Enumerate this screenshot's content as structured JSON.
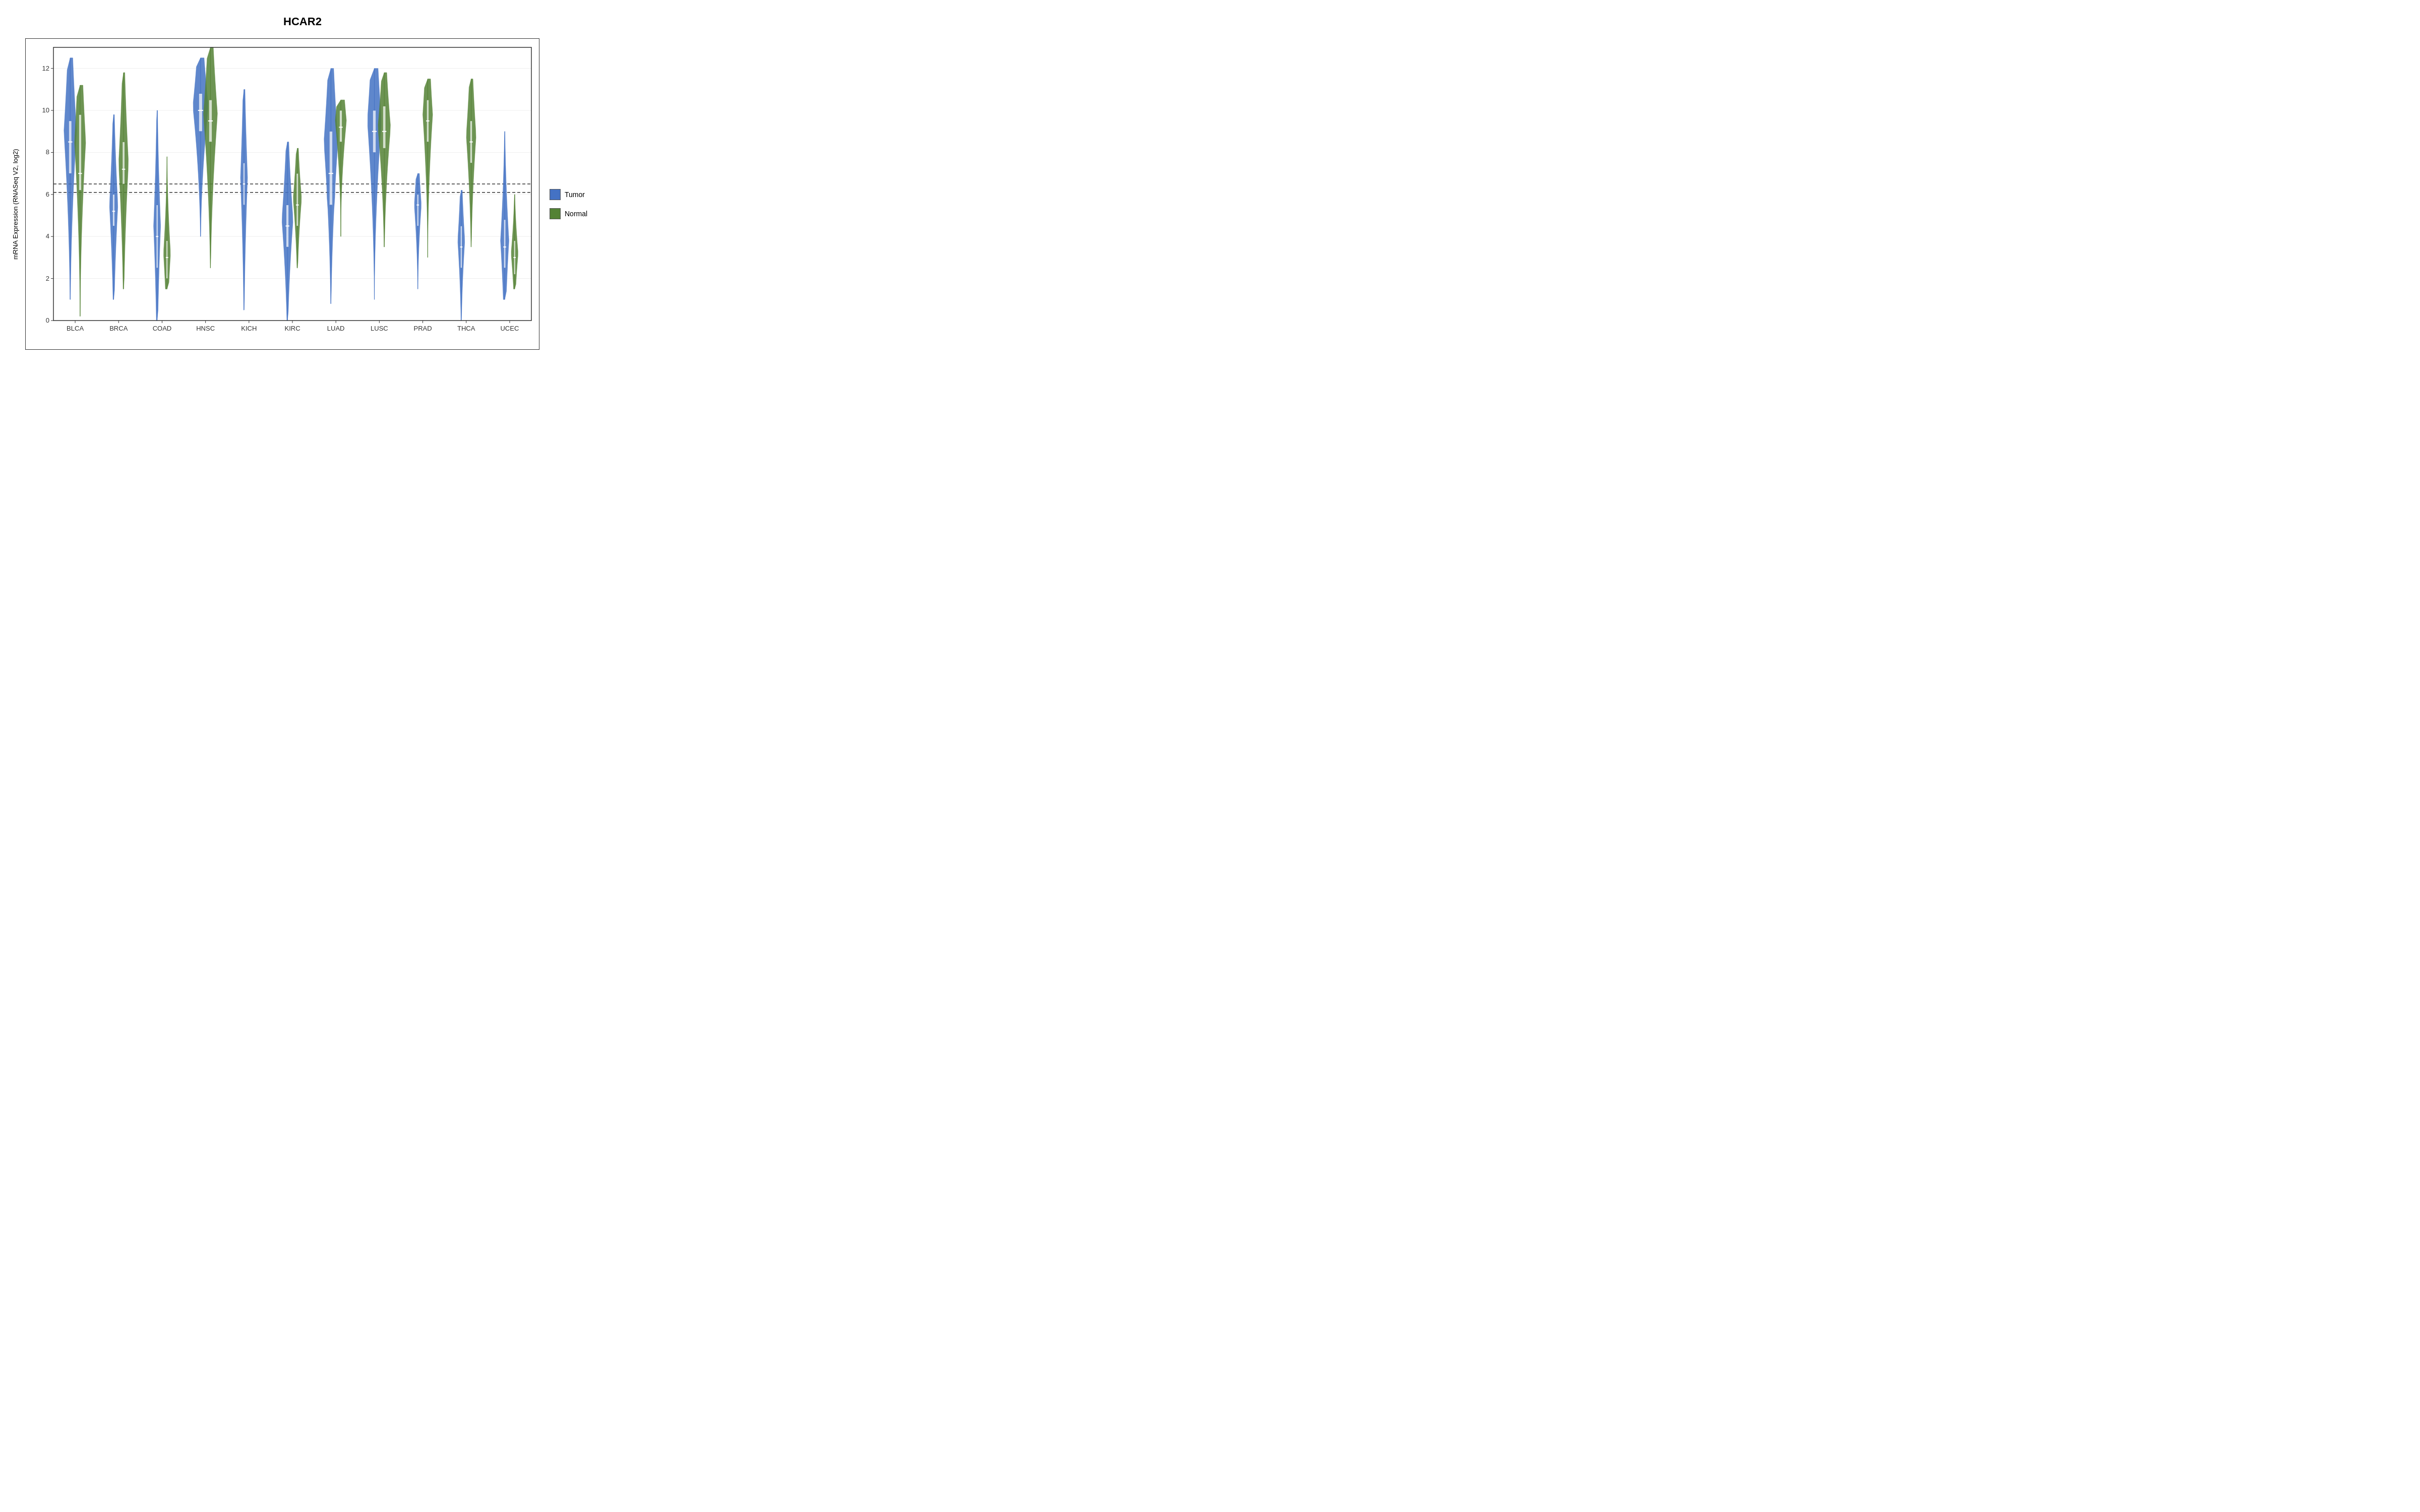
{
  "title": "HCAR2",
  "yAxisLabel": "mRNA Expression (RNASeq V2, log2)",
  "legend": {
    "tumor": {
      "label": "Tumor",
      "color": "#4472C4"
    },
    "normal": {
      "label": "Normal",
      "color": "#548235"
    }
  },
  "yAxis": {
    "min": 0,
    "max": 13,
    "ticks": [
      0,
      2,
      4,
      6,
      8,
      10,
      12
    ]
  },
  "referenceLine1": 6.5,
  "referenceLine2": 6.1,
  "cancerTypes": [
    "BLCA",
    "BRCA",
    "COAD",
    "HNSC",
    "KICH",
    "KIRC",
    "LUAD",
    "LUSC",
    "PRAD",
    "THCA",
    "UCEC"
  ],
  "violins": {
    "BLCA": {
      "tumor": {
        "median": 8.5,
        "q1": 7.0,
        "q3": 9.5,
        "min": 1.0,
        "max": 12.5,
        "mode": 9.0,
        "width": 0.9
      },
      "normal": {
        "median": 7.0,
        "q1": 6.2,
        "q3": 9.8,
        "min": 0.2,
        "max": 11.2,
        "mode": 8.5,
        "width": 0.8
      }
    },
    "BRCA": {
      "tumor": {
        "median": 5.2,
        "q1": 4.5,
        "q3": 6.0,
        "min": 1.0,
        "max": 9.8,
        "mode": 5.5,
        "width": 0.6
      },
      "normal": {
        "median": 7.2,
        "q1": 6.5,
        "q3": 8.5,
        "min": 1.5,
        "max": 11.8,
        "mode": 7.5,
        "width": 0.7
      }
    },
    "COAD": {
      "tumor": {
        "median": 4.0,
        "q1": 2.5,
        "q3": 5.5,
        "min": 0.0,
        "max": 10.0,
        "mode": 4.5,
        "width": 0.5
      },
      "normal": {
        "median": 3.0,
        "q1": 2.0,
        "q3": 3.8,
        "min": 1.5,
        "max": 7.8,
        "mode": 3.2,
        "width": 0.5
      }
    },
    "HNSC": {
      "tumor": {
        "median": 10.0,
        "q1": 9.0,
        "q3": 10.8,
        "min": 4.0,
        "max": 12.5,
        "mode": 10.2,
        "width": 1.1
      },
      "normal": {
        "median": 9.5,
        "q1": 8.5,
        "q3": 10.5,
        "min": 2.5,
        "max": 13.0,
        "mode": 9.8,
        "width": 1.0
      }
    },
    "KICH": {
      "tumor": {
        "median": 6.5,
        "q1": 5.5,
        "q3": 7.5,
        "min": 0.5,
        "max": 11.0,
        "mode": 6.8,
        "width": 0.5
      },
      "normal": null
    },
    "KIRC": {
      "tumor": {
        "median": 4.5,
        "q1": 3.5,
        "q3": 5.5,
        "min": 0.0,
        "max": 8.5,
        "mode": 4.8,
        "width": 0.8
      },
      "normal": {
        "median": 5.5,
        "q1": 4.5,
        "q3": 7.0,
        "min": 2.5,
        "max": 8.2,
        "mode": 5.8,
        "width": 0.6
      }
    },
    "LUAD": {
      "tumor": {
        "median": 7.0,
        "q1": 5.5,
        "q3": 9.0,
        "min": 0.8,
        "max": 12.0,
        "mode": 8.5,
        "width": 1.0
      },
      "normal": {
        "median": 9.2,
        "q1": 8.5,
        "q3": 10.0,
        "min": 4.0,
        "max": 10.5,
        "mode": 9.5,
        "width": 0.8
      }
    },
    "LUSC": {
      "tumor": {
        "median": 9.0,
        "q1": 8.0,
        "q3": 10.0,
        "min": 1.0,
        "max": 12.0,
        "mode": 9.5,
        "width": 1.0
      },
      "normal": {
        "median": 9.0,
        "q1": 8.2,
        "q3": 10.2,
        "min": 3.5,
        "max": 11.8,
        "mode": 9.2,
        "width": 0.9
      }
    },
    "PRAD": {
      "tumor": {
        "median": 5.5,
        "q1": 4.5,
        "q3": 6.0,
        "min": 1.5,
        "max": 7.0,
        "mode": 5.5,
        "width": 0.5
      },
      "normal": {
        "median": 9.5,
        "q1": 8.5,
        "q3": 10.5,
        "min": 3.0,
        "max": 11.5,
        "mode": 9.8,
        "width": 0.7
      }
    },
    "THCA": {
      "tumor": {
        "median": 3.5,
        "q1": 2.5,
        "q3": 4.5,
        "min": 0.0,
        "max": 6.2,
        "mode": 3.8,
        "width": 0.5
      },
      "normal": {
        "median": 8.5,
        "q1": 7.5,
        "q3": 9.5,
        "min": 3.5,
        "max": 11.5,
        "mode": 8.8,
        "width": 0.7
      }
    },
    "UCEC": {
      "tumor": {
        "median": 3.5,
        "q1": 2.5,
        "q3": 4.8,
        "min": 1.0,
        "max": 9.0,
        "mode": 3.8,
        "width": 0.6
      },
      "normal": {
        "median": 3.0,
        "q1": 2.2,
        "q3": 3.8,
        "min": 1.5,
        "max": 6.0,
        "mode": 3.2,
        "width": 0.5
      }
    }
  }
}
